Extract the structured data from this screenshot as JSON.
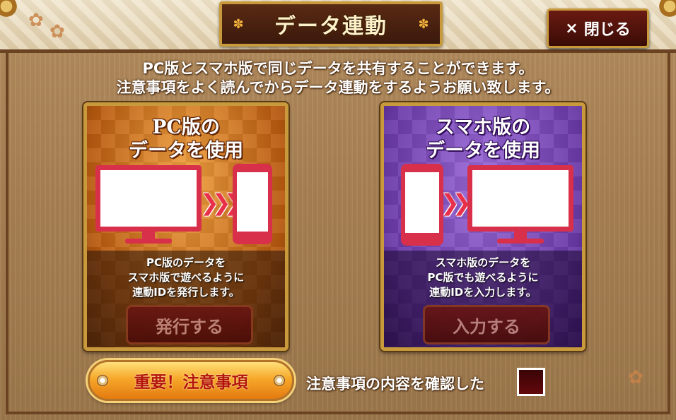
{
  "dialog": {
    "title": "データ連動",
    "close_label": "閉じる",
    "close_icon": "×",
    "intro_line1": "PC版とスマホ版で同じデータを共有することができます。",
    "intro_line2": "注意事項をよく読んでからデータ連動をするようお願い致します。"
  },
  "pc_panel": {
    "title_line1": "PC版の",
    "title_line2": "データを使用",
    "desc_line1": "PC版のデータを",
    "desc_line2": "スマホ版で遊べるように",
    "desc_line3": "連動IDを発行します。",
    "button_label": "発行する",
    "accent_color": "#d8304a"
  },
  "sp_panel": {
    "title_line1": "スマホ版の",
    "title_line2": "データを使用",
    "desc_line1": "スマホ版のデータを",
    "desc_line2": "PC版でも遊べるように",
    "desc_line3": "連動IDを入力します。",
    "button_label": "入力する",
    "accent_color": "#d8304a"
  },
  "footer": {
    "warning_button_label": "重要！注意事項",
    "confirm_label": "注意事項の内容を確認した",
    "confirm_checked": false
  },
  "icons": {
    "arrows": "❯❯❯"
  }
}
